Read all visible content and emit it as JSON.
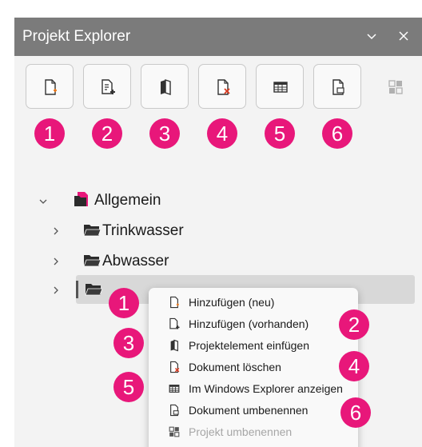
{
  "window": {
    "title": "Projekt Explorer"
  },
  "colors": {
    "accent": "#e8177a",
    "titlebar": "#7b7b7b",
    "background": "#f3f3f3"
  },
  "toolbar": {
    "buttons": [
      {
        "name": "add-new",
        "icon": "new-document-icon",
        "badge": "1"
      },
      {
        "name": "add-existing",
        "icon": "add-document-icon",
        "badge": "2"
      },
      {
        "name": "insert-project-element",
        "icon": "book-icon",
        "badge": "3"
      },
      {
        "name": "delete-document",
        "icon": "delete-document-icon",
        "badge": "4"
      },
      {
        "name": "show-in-explorer",
        "icon": "grid-icon",
        "badge": "5"
      },
      {
        "name": "rename-document",
        "icon": "rename-document-icon",
        "badge": "6"
      },
      {
        "name": "rename-project",
        "icon": "rename-project-icon",
        "badge": ""
      }
    ]
  },
  "tree": {
    "root": {
      "label": "Allgemein",
      "expanded": true
    },
    "children": [
      {
        "label": "Trinkwasser"
      },
      {
        "label": "Abwasser"
      },
      {
        "label": "",
        "selected": true
      }
    ]
  },
  "context_menu": {
    "items": [
      {
        "label": "Hinzufügen (neu)",
        "icon": "new-document-icon",
        "badge": "1"
      },
      {
        "label": "Hinzufügen (vorhanden)",
        "icon": "add-document-icon",
        "badge": "2"
      },
      {
        "label": "Projektelement einfügen",
        "icon": "book-icon",
        "badge": "3"
      },
      {
        "label": "Dokument löschen",
        "icon": "delete-document-icon",
        "badge": "4"
      },
      {
        "label": "Im Windows Explorer anzeigen",
        "icon": "grid-icon",
        "badge": "5"
      },
      {
        "label": "Dokument umbenennen",
        "icon": "rename-document-icon",
        "badge": "6"
      },
      {
        "label": "Projekt umbenennen",
        "icon": "rename-project-icon",
        "disabled": true
      }
    ]
  }
}
